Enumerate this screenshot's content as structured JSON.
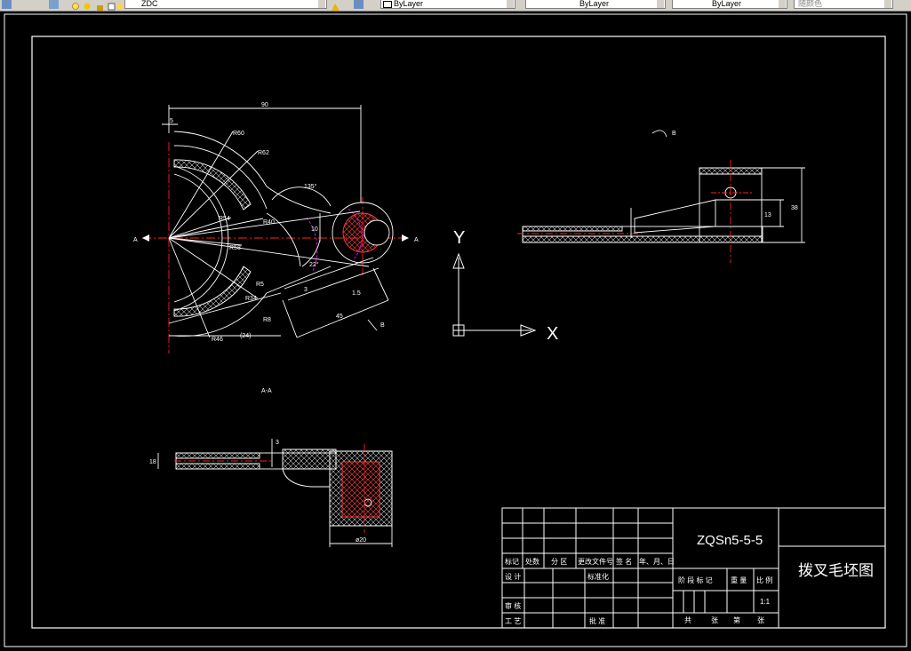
{
  "toolbar": {
    "layer_combo": "ZDC",
    "linetype_combo": "ByLayer",
    "lineweight_combo": "ByLayer",
    "color_combo": "ByLayer",
    "plotstyle_combo": "随颜色"
  },
  "view_labels": {
    "section_left": "A",
    "section_right": "A",
    "view_b_arrow": "B",
    "view_b_title": "B",
    "section_title": "A-A"
  },
  "dims_front": {
    "overall_width": "90",
    "offset": "5",
    "r60": "R60",
    "r62": "R62",
    "r54": "R54",
    "r40": "R40",
    "r58": "R58",
    "r34": "R34",
    "r46": "R46",
    "r5": "R5",
    "r8": "R8",
    "angle_135": "135°",
    "angle_22": "22°",
    "d10": "10",
    "d45": "45",
    "d15": "1.5",
    "d3": "3",
    "d24": "(24)"
  },
  "dims_b": {
    "height_38": "38",
    "height_13": "13"
  },
  "dims_section": {
    "d18": "18",
    "d3": "3",
    "width_20": "ø20"
  },
  "ucs": {
    "y": "Y",
    "x": "X"
  },
  "title_block": {
    "material": "ZQSn5-5-5",
    "title": "拨叉毛坯图",
    "h_mark": "标记",
    "h_count": "处数",
    "h_zone": "分 区",
    "h_docno": "更改文件号",
    "h_sign": "签 名",
    "h_date": "年、月、日",
    "design": "设 计",
    "standard": "标准化",
    "review": "审 核",
    "process": "工 艺",
    "approve": "批 准",
    "stage": "阶 段 标 记",
    "weight": "重 量",
    "scale_label": "比 例",
    "scale_value": "1:1",
    "total": "共",
    "sheets": "张",
    "nth": "第",
    "sheet": "张"
  },
  "colors": {
    "background": "#000000",
    "lines": "#ffffff",
    "centerline": "#ff0000",
    "hidden": "#ff00ff"
  }
}
